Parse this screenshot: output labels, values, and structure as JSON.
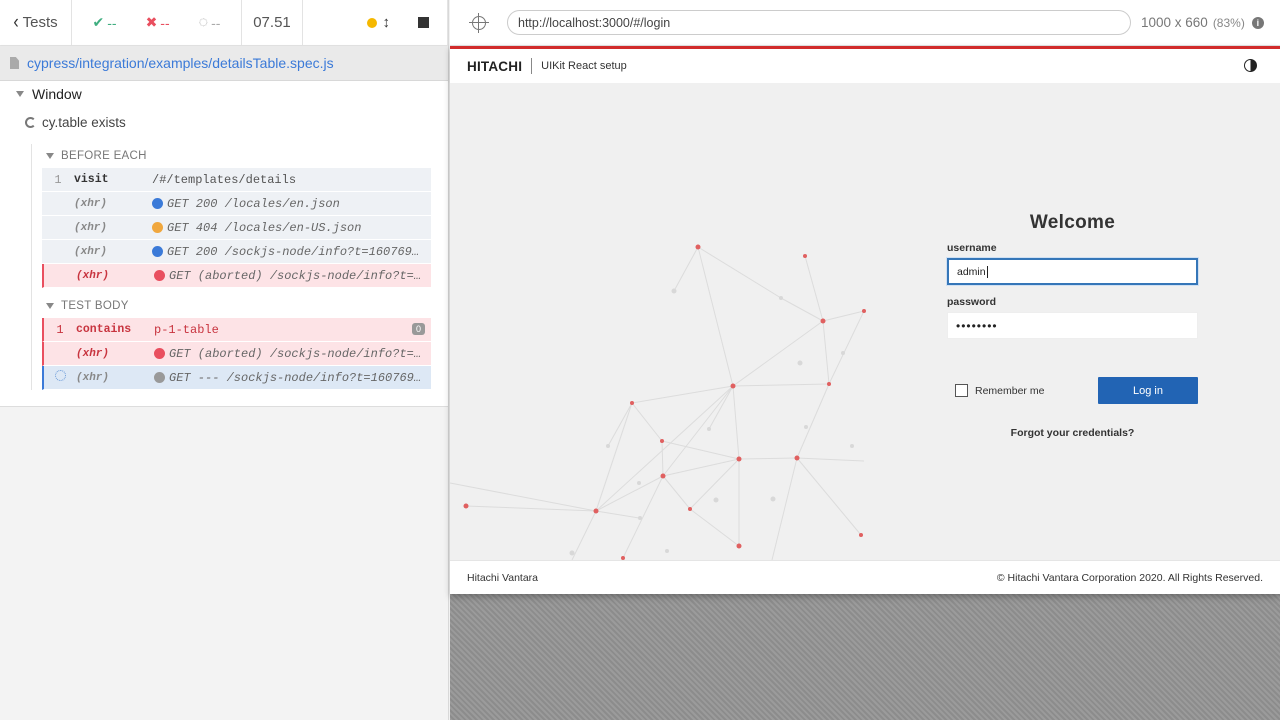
{
  "reporter": {
    "tests_label": "Tests",
    "passed": "--",
    "failed": "--",
    "pending": "--",
    "duration": "07.51",
    "spec_path": "cypress/integration/examples/detailsTable.spec.js",
    "suite": "Window",
    "test": "cy.table exists",
    "before_each_label": "BEFORE EACH",
    "test_body_label": "TEST BODY",
    "before_each": [
      {
        "num": "1",
        "name": "visit",
        "msg": "/#/templates/details",
        "type": "normal"
      },
      {
        "num": "",
        "name": "(xhr)",
        "msg": "GET 200 /locales/en.json",
        "type": "xhr",
        "dot": "#3b7ad8"
      },
      {
        "num": "",
        "name": "(xhr)",
        "msg": "GET 404 /locales/en-US.json",
        "type": "xhr",
        "dot": "#f0a73e"
      },
      {
        "num": "",
        "name": "(xhr)",
        "msg": "GET 200 /sockjs-node/info?t=160769…",
        "type": "xhr",
        "dot": "#3b7ad8"
      },
      {
        "num": "",
        "name": "(xhr)",
        "msg": "GET (aborted) /sockjs-node/info?t=…",
        "type": "xhr-failed",
        "dot": "#e94f5f"
      }
    ],
    "test_body": [
      {
        "num": "1",
        "name": "contains",
        "msg": "p-1-table",
        "badge": "0",
        "type": "failed"
      },
      {
        "num": "",
        "name": "(xhr)",
        "msg": "GET (aborted) /sockjs-node/info?t=…",
        "type": "xhr-failed",
        "dot": "#e94f5f"
      },
      {
        "num": "",
        "name": "(xhr)",
        "msg": "GET --- /sockjs-node/info?t=160769…",
        "type": "xhr-pending",
        "dot": "#999999"
      }
    ]
  },
  "aut": {
    "url": "http://localhost:3000/#/login",
    "viewport": "1000 x 660",
    "scale": "(83%)",
    "brand": "HITACHI",
    "app_title": "UIKit React setup",
    "welcome": "Welcome",
    "username_label": "username",
    "username_value": "admin",
    "password_label": "password",
    "password_value": "••••••••",
    "remember_label": "Remember me",
    "login_label": "Log in",
    "forgot_label": "Forgot your credentials?",
    "footer_left": "Hitachi Vantara",
    "footer_right": "© Hitachi Vantara Corporation 2020. All Rights Reserved."
  },
  "colors": {
    "accent_red": "#d12b2b",
    "primary_blue": "#2264b4",
    "pass_green": "#3fae80",
    "fail_red": "#e94f5f"
  }
}
